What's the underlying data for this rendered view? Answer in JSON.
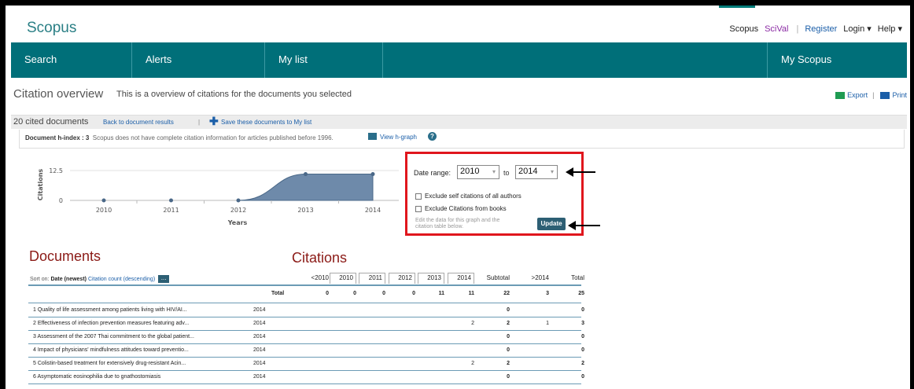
{
  "header": {
    "logo": "Scopus",
    "links": {
      "scopus": "Scopus",
      "scival": "SciVal",
      "register": "Register",
      "login": "Login ▾",
      "help": "Help ▾"
    }
  },
  "nav": {
    "search": "Search",
    "alerts": "Alerts",
    "mylist": "My list",
    "myscopus": "My Scopus"
  },
  "title": {
    "main": "Citation overview",
    "sub": "This is a overview of citations for the documents you selected",
    "export": "Export",
    "print": "Print"
  },
  "cited": {
    "count": "20 cited documents",
    "back": "Back to document results",
    "save": "Save these documents to My list"
  },
  "hindex": {
    "label": "Document h-index : 3",
    "note": "Scopus does not have complete citation information for articles published before 1996.",
    "view": "View h-graph",
    "help": "?"
  },
  "chart_data": {
    "type": "area",
    "x": [
      2010,
      2011,
      2012,
      2013,
      2014
    ],
    "values": [
      0,
      0,
      0,
      11,
      11
    ],
    "xlabel": "Years",
    "ylabel": "Citations",
    "yticks": [
      "12.5",
      "0"
    ],
    "ylim": [
      0,
      12.5
    ]
  },
  "date_panel": {
    "label": "Date range:",
    "from": "2010",
    "to_label": "to",
    "to": "2014",
    "exclude_self": "Exclude self citations of all authors",
    "exclude_books": "Exclude Citations from books",
    "hint": "Edit the data for this graph and the citation table below.",
    "update": "Update"
  },
  "documents": {
    "heading": "Documents",
    "sort_on": "Sort on:",
    "sort_date": "Date (newest)",
    "sort_citation": "Citation count (descending)",
    "more": "...",
    "rows": [
      {
        "title": "1 Quality of life assessment among patients living with HIV/AI...",
        "year": "2014"
      },
      {
        "title": "2 Effectiveness of infection prevention measures featuring adv...",
        "year": "2014"
      },
      {
        "title": "3 Assessment of the 2007 Thai commitment to the global patient...",
        "year": "2014"
      },
      {
        "title": "4 Impact of physicians' mindfulness attitudes toward preventio...",
        "year": "2014"
      },
      {
        "title": "5 Colistin-based treatment for extensively drug-resistant Acin...",
        "year": "2014"
      },
      {
        "title": "6 Asymptomatic eosinophilia due to gnathostomiasis",
        "year": "2014"
      }
    ]
  },
  "citations": {
    "heading": "Citations",
    "columns": [
      "<2010",
      "2010",
      "2011",
      "2012",
      "2013",
      "2014",
      "Subtotal",
      ">2014",
      "Total"
    ],
    "total_label": "Total",
    "totals": [
      "0",
      "0",
      "0",
      "0",
      "11",
      "11",
      "22",
      "3",
      "25"
    ],
    "rows": [
      [
        "",
        "",
        "",
        "",
        "",
        "",
        "0",
        "",
        "0"
      ],
      [
        "",
        "",
        "",
        "",
        "",
        "2",
        "2",
        "1",
        "3"
      ],
      [
        "",
        "",
        "",
        "",
        "",
        "",
        "0",
        "",
        "0"
      ],
      [
        "",
        "",
        "",
        "",
        "",
        "",
        "0",
        "",
        "0"
      ],
      [
        "",
        "",
        "",
        "",
        "",
        "2",
        "2",
        "",
        "2"
      ],
      [
        "",
        "",
        "",
        "",
        "",
        "",
        "0",
        "",
        "0"
      ]
    ]
  }
}
